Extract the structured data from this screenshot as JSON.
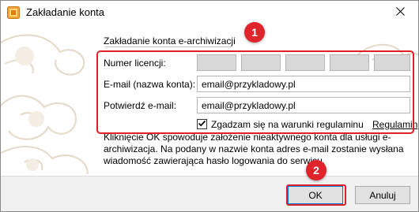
{
  "window": {
    "title": "Zakładanie konta"
  },
  "form": {
    "section_title": "Zakładanie konta e-archiwizacji",
    "license_label": "Numer licencji:",
    "email_label": "E-mail (nazwa konta):",
    "email_value": "email@przykladowy.pl",
    "confirm_label": "Potwierdź e-mail:",
    "confirm_value": "email@przykladowy.pl",
    "agree_label": "Zgadzam się na warunki regulaminu",
    "agree_checked": true,
    "regulations_link": "Regulamin"
  },
  "info_text": "Kliknięcie OK spowoduje założenie nieaktywnego konta dla usługi e-archiwizacja. Na podany w nazwie konta adres e-mail zostanie wysłana wiadomość zawierająca hasło logowania do serwisu.",
  "buttons": {
    "ok": "OK",
    "cancel": "Anuluj"
  },
  "markers": [
    "1",
    "2"
  ],
  "colors": {
    "highlight": "#e01f26",
    "ok_border": "#0078d7"
  },
  "icons": {
    "app": "app-icon",
    "close": "close-icon",
    "check": "checkmark-icon"
  }
}
